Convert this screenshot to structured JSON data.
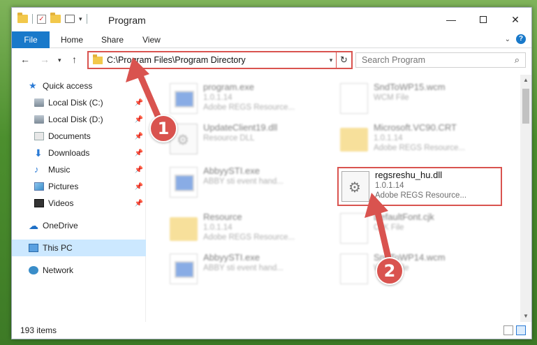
{
  "window": {
    "title": "Program",
    "minimize": "—",
    "close": "✕"
  },
  "ribbon": {
    "tabs": [
      {
        "label": "File"
      },
      {
        "label": "Home"
      },
      {
        "label": "Share"
      },
      {
        "label": "View"
      }
    ],
    "accent": "#1979ca"
  },
  "navbar": {
    "back": "←",
    "forward": "→",
    "recent": "▾",
    "up": "↑",
    "address": "C:\\Program Files\\Program Directory",
    "refresh": "↻",
    "search_placeholder": "Search Program",
    "search_icon": "⌕"
  },
  "sidebar": {
    "items": [
      {
        "label": "Quick access",
        "icon": "star-icon"
      },
      {
        "label": "Local Disk (C:)",
        "icon": "disk-icon",
        "pinned": true
      },
      {
        "label": "Local Disk (D:)",
        "icon": "disk-icon",
        "pinned": true
      },
      {
        "label": "Documents",
        "icon": "documents-icon",
        "pinned": true
      },
      {
        "label": "Downloads",
        "icon": "downloads-icon",
        "pinned": true
      },
      {
        "label": "Music",
        "icon": "music-icon",
        "pinned": true
      },
      {
        "label": "Pictures",
        "icon": "pictures-icon",
        "pinned": true
      },
      {
        "label": "Videos",
        "icon": "videos-icon",
        "pinned": true
      },
      {
        "label": "OneDrive",
        "icon": "onedrive-icon"
      },
      {
        "label": "This PC",
        "icon": "pc-icon",
        "selected": true
      },
      {
        "label": "Network",
        "icon": "network-icon"
      }
    ]
  },
  "files": [
    {
      "name": "program.exe",
      "line2": "1.0.1.14",
      "line3": "Adobe REGS Resource...",
      "icon": "exe"
    },
    {
      "name": "SndToWP15.wcm",
      "line2": "WCM File",
      "line3": "",
      "icon": "blank"
    },
    {
      "name": "UpdateClient19.dll",
      "line2": "Resource DLL",
      "line3": "",
      "icon": "dll"
    },
    {
      "name": "Microsoft.VC90.CRT",
      "line2": "1.0.1.14",
      "line3": "Adobe REGS Resource...",
      "icon": "folder"
    },
    {
      "name": "AbbyySTI.exe",
      "line2": "ABBY sti event hand...",
      "line3": "",
      "icon": "exe"
    },
    {
      "name": "regsreshu_hu.dll",
      "line2": "1.0.1.14",
      "line3": "Adobe REGS Resource...",
      "icon": "dll",
      "highlight": true
    },
    {
      "name": "Resource",
      "line2": "1.0.1.14",
      "line3": "Adobe REGS Resource...",
      "icon": "folder"
    },
    {
      "name": "DefaultFont.cjk",
      "line2": "CJK File",
      "line3": "",
      "icon": "blank"
    },
    {
      "name": "AbbyySTI.exe",
      "line2": "ABBY sti event hand...",
      "line3": "",
      "icon": "exe"
    },
    {
      "name": "SndToWP14.wcm",
      "line2": "WCM File",
      "line3": "",
      "icon": "blank"
    }
  ],
  "status": {
    "count": "193 items"
  },
  "annotations": {
    "badge1": "1",
    "badge2": "2",
    "color": "#d9534f"
  }
}
